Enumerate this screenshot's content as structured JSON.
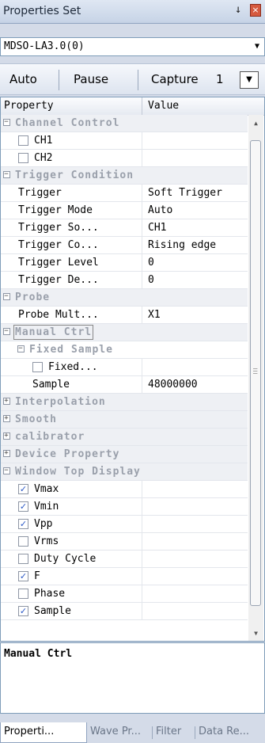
{
  "panel": {
    "title": "Properties Set",
    "pin_glyph": "↓",
    "close_glyph": "×"
  },
  "device": {
    "selected": "MDSO-LA3.0(0)"
  },
  "toolbar": {
    "auto": "Auto",
    "pause": "Pause",
    "capture": "Capture",
    "capture_count": "1"
  },
  "grid": {
    "header_property": "Property",
    "header_value": "Value",
    "rows": [
      {
        "kind": "category",
        "label": "Channel Control",
        "expanded": true
      },
      {
        "kind": "item",
        "label": "CH1",
        "checkbox": true,
        "checked": false
      },
      {
        "kind": "item",
        "label": "CH2",
        "checkbox": true,
        "checked": false
      },
      {
        "kind": "category",
        "label": "Trigger Condition",
        "expanded": true
      },
      {
        "kind": "item",
        "label": "Trigger",
        "value": "Soft Trigger"
      },
      {
        "kind": "item",
        "label": "Trigger Mode",
        "value": "Auto"
      },
      {
        "kind": "item",
        "label": "Trigger So...",
        "value": "CH1"
      },
      {
        "kind": "item",
        "label": "Trigger Co...",
        "value": "Rising edge"
      },
      {
        "kind": "item",
        "label": "Trigger Level",
        "value": "0"
      },
      {
        "kind": "item",
        "label": "Trigger De...",
        "value": "0"
      },
      {
        "kind": "category",
        "label": "Probe",
        "expanded": true
      },
      {
        "kind": "item",
        "label": "Probe Mult...",
        "value": "X1"
      },
      {
        "kind": "category",
        "label": "Manual Ctrl",
        "expanded": true,
        "focused": true
      },
      {
        "kind": "subcategory",
        "label": "Fixed Sample",
        "expanded": true
      },
      {
        "kind": "subitem",
        "label": "Fixed...",
        "checkbox": true,
        "checked": false
      },
      {
        "kind": "subitem",
        "label": "Sample",
        "value": "48000000"
      },
      {
        "kind": "category",
        "label": "Interpolation",
        "expanded": false
      },
      {
        "kind": "category",
        "label": "Smooth",
        "expanded": false
      },
      {
        "kind": "category",
        "label": "calibrator",
        "expanded": false
      },
      {
        "kind": "category",
        "label": "Device Property",
        "expanded": false
      },
      {
        "kind": "category",
        "label": "Window Top Display",
        "expanded": true
      },
      {
        "kind": "item",
        "label": "Vmax",
        "checkbox": true,
        "checked": true
      },
      {
        "kind": "item",
        "label": "Vmin",
        "checkbox": true,
        "checked": true
      },
      {
        "kind": "item",
        "label": "Vpp",
        "checkbox": true,
        "checked": true
      },
      {
        "kind": "item",
        "label": "Vrms",
        "checkbox": true,
        "checked": false
      },
      {
        "kind": "item",
        "label": "Duty Cycle",
        "checkbox": true,
        "checked": false
      },
      {
        "kind": "item",
        "label": "F",
        "checkbox": true,
        "checked": true
      },
      {
        "kind": "item",
        "label": "Phase",
        "checkbox": true,
        "checked": false
      },
      {
        "kind": "item",
        "label": "Sample",
        "checkbox": true,
        "checked": true
      }
    ]
  },
  "description": {
    "title": "Manual Ctrl"
  },
  "tabs": [
    {
      "label": "Properti...",
      "active": true
    },
    {
      "label": "Wave Pr...",
      "active": false
    },
    {
      "label": "Filter",
      "active": false
    },
    {
      "label": "Data Re...",
      "active": false
    }
  ],
  "colors": {
    "category_text": "#9aa0ab",
    "check_blue": "#2a58c6",
    "panel_bg": "#d4dbe8"
  }
}
